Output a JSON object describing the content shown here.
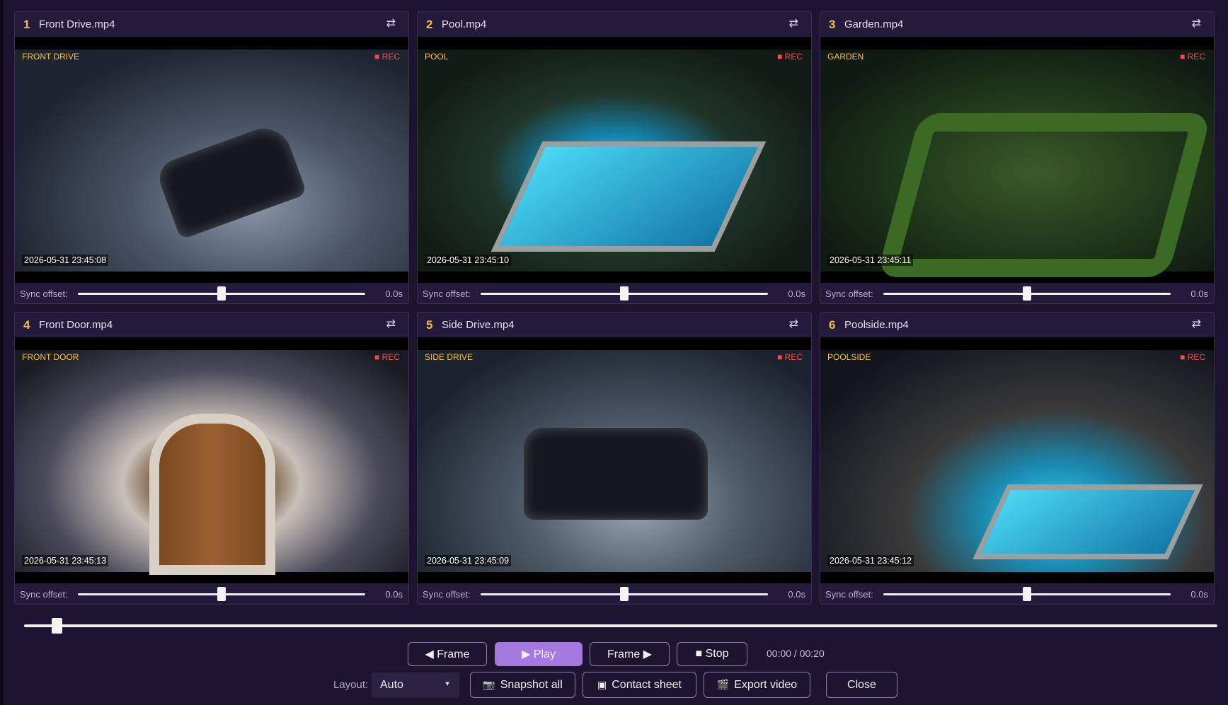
{
  "panels": [
    {
      "num": "1",
      "file": "Front Drive.mp4",
      "label": "FRONT DRIVE",
      "rec": "■ REC",
      "timestamp": "2026-05-31 23:45:08",
      "sync_label": "Sync offset:",
      "sync_value": "0.0s",
      "sync_offset_fraction": 0.5
    },
    {
      "num": "2",
      "file": "Pool.mp4",
      "label": "POOL",
      "rec": "■ REC",
      "timestamp": "2026-05-31 23:45:10",
      "sync_label": "Sync offset:",
      "sync_value": "0.0s",
      "sync_offset_fraction": 0.5
    },
    {
      "num": "3",
      "file": "Garden.mp4",
      "label": "GARDEN",
      "rec": "■ REC",
      "timestamp": "2026-05-31 23:45:11",
      "sync_label": "Sync offset:",
      "sync_value": "0.0s",
      "sync_offset_fraction": 0.5
    },
    {
      "num": "4",
      "file": "Front Door.mp4",
      "label": "FRONT DOOR",
      "rec": "■ REC",
      "timestamp": "2026-05-31 23:45:13",
      "sync_label": "Sync offset:",
      "sync_value": "0.0s",
      "sync_offset_fraction": 0.5
    },
    {
      "num": "5",
      "file": "Side Drive.mp4",
      "label": "SIDE DRIVE",
      "rec": "■ REC",
      "timestamp": "2026-05-31 23:45:09",
      "sync_label": "Sync offset:",
      "sync_value": "0.0s",
      "sync_offset_fraction": 0.5
    },
    {
      "num": "6",
      "file": "Poolside.mp4",
      "label": "POOLSIDE",
      "rec": "■ REC",
      "timestamp": "2026-05-31 23:45:12",
      "sync_label": "Sync offset:",
      "sync_value": "0.0s",
      "sync_offset_fraction": 0.5
    }
  ],
  "swap_icon": "⇄",
  "timeline": {
    "progress_fraction": 0.027
  },
  "controls": {
    "prev_frame": "◀ Frame",
    "play": "▶ Play",
    "next_frame": "Frame ▶",
    "stop": "■ Stop",
    "time": "00:00 / 00:20"
  },
  "bottom": {
    "layout_label": "Layout:",
    "layout_value": "Auto",
    "snapshot_all": "Snapshot all",
    "contact_sheet": "Contact sheet",
    "export_video": "Export video",
    "close": "Close"
  },
  "colors": {
    "accent": "#a27ae0",
    "label": "#ffc520",
    "rec": "#ff4a4a",
    "background": "#1d1530"
  }
}
